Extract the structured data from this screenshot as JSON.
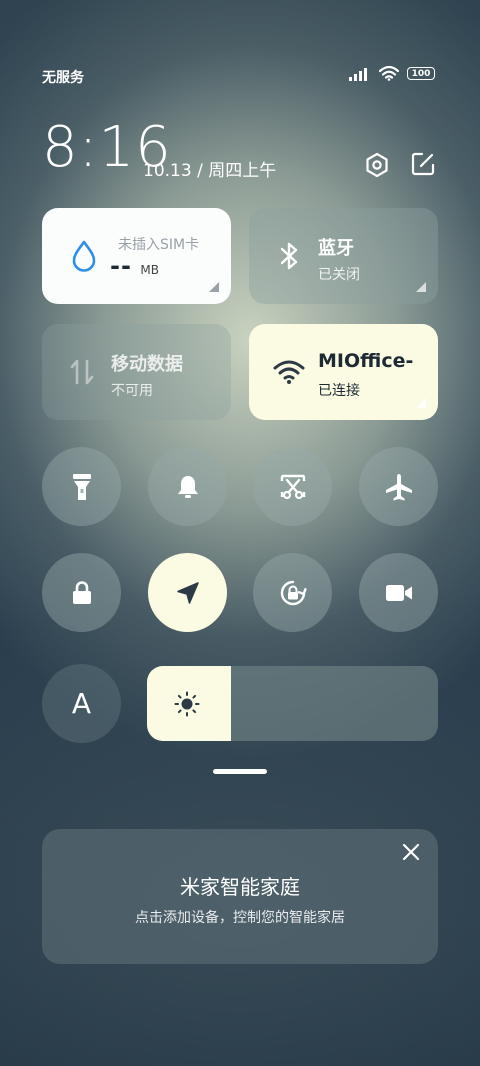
{
  "status_bar": {
    "carrier": "无服务",
    "battery": "100",
    "icons": [
      "signal-icon",
      "wifi-icon",
      "battery-icon"
    ]
  },
  "header": {
    "time": "8:16",
    "date": "10.13 / 周四上午",
    "icons": [
      "settings-icon",
      "edit-icon"
    ]
  },
  "tiles": {
    "sim": {
      "title": "未插入SIM卡",
      "value": "--",
      "unit": "MB",
      "icon": "water-drop-icon"
    },
    "bluetooth": {
      "title": "蓝牙",
      "status": "已关闭",
      "icon": "bluetooth-icon"
    },
    "mobile_data": {
      "title": "移动数据",
      "status": "不可用",
      "icon": "data-arrows-icon"
    },
    "wifi": {
      "title": "MIOffice-",
      "status": "已连接",
      "icon": "wifi-icon"
    }
  },
  "toggles": [
    {
      "name": "flashlight",
      "icon": "flashlight-icon",
      "active": false
    },
    {
      "name": "mute",
      "icon": "bell-icon",
      "active": false
    },
    {
      "name": "screenshot",
      "icon": "screenshot-scissors-icon",
      "active": false
    },
    {
      "name": "airplane",
      "icon": "airplane-icon",
      "active": false
    },
    {
      "name": "lock",
      "icon": "lock-icon",
      "active": false
    },
    {
      "name": "location",
      "icon": "location-arrow-icon",
      "active": true
    },
    {
      "name": "rotation-lock",
      "icon": "rotation-lock-icon",
      "active": false
    },
    {
      "name": "screen-record",
      "icon": "video-camera-icon",
      "active": false
    }
  ],
  "auto_brightness": {
    "label": "A"
  },
  "brightness": {
    "level": 0.29,
    "icon": "sun-icon"
  },
  "smart_home": {
    "title": "米家智能家庭",
    "subtitle": "点击添加设备，控制您的智能家居",
    "close_icon": "close-icon"
  },
  "colors": {
    "active_tile": "#fbfbe4",
    "white_tile": "#fbfcfc",
    "accent_blue": "#2f8fe6",
    "dark_icon": "#2d3a46"
  }
}
